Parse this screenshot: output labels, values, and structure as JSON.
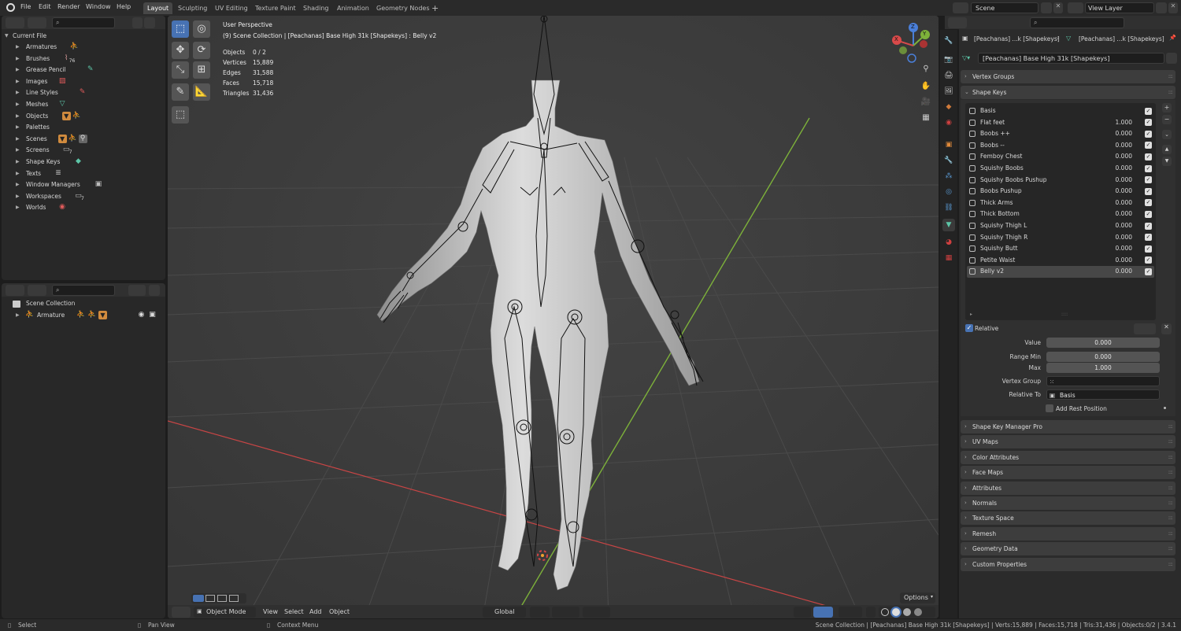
{
  "menu": {
    "items": [
      "File",
      "Edit",
      "Render",
      "Window",
      "Help"
    ],
    "workspaces": [
      "Layout",
      "Sculpting",
      "UV Editing",
      "Texture Paint",
      "Shading",
      "Animation",
      "Geometry Nodes"
    ],
    "add_tab": "+",
    "scene_name": "Scene",
    "view_layer": "View Layer"
  },
  "outliner_top": {
    "root": "Current File",
    "items": [
      {
        "label": "Armatures",
        "icon": "armature-icon"
      },
      {
        "label": "Brushes",
        "icon": "brush-icon",
        "count": "76"
      },
      {
        "label": "Grease Pencil",
        "icon": "grease-pencil-icon"
      },
      {
        "label": "Images",
        "icon": "image-icon"
      },
      {
        "label": "Line Styles",
        "icon": "line-style-icon"
      },
      {
        "label": "Meshes",
        "icon": "mesh-icon"
      },
      {
        "label": "Objects",
        "icon": "object-icon"
      },
      {
        "label": "Palettes",
        "icon": ""
      },
      {
        "label": "Scenes",
        "icon": "scene-icon"
      },
      {
        "label": "Screens",
        "icon": "screen-icon",
        "count": "7"
      },
      {
        "label": "Shape Keys",
        "icon": "shape-key-icon"
      },
      {
        "label": "Texts",
        "icon": "text-icon"
      },
      {
        "label": "Window Managers",
        "icon": "window-icon"
      },
      {
        "label": "Workspaces",
        "icon": "workspace-icon",
        "count": "7"
      },
      {
        "label": "Worlds",
        "icon": "world-icon"
      }
    ]
  },
  "outliner_bottom": {
    "collection": "Scene Collection",
    "armature": "Armature"
  },
  "viewport": {
    "perspective": "User Perspective",
    "collection_path": "(9) Scene Collection | [Peachanas] Base High 31k [Shapekeys] : Belly v2",
    "stats": [
      {
        "k": "Objects",
        "v": "0 / 2"
      },
      {
        "k": "Vertices",
        "v": "15,889"
      },
      {
        "k": "Edges",
        "v": "31,588"
      },
      {
        "k": "Faces",
        "v": "15,718"
      },
      {
        "k": "Triangles",
        "v": "31,436"
      }
    ],
    "gizmo": {
      "x": "X",
      "y": "Y",
      "z": "Z"
    },
    "options": "Options",
    "header": {
      "mode": "Object Mode",
      "menus": [
        "View",
        "Select",
        "Add",
        "Object"
      ],
      "orientation": "Global"
    },
    "colors": {
      "x_axis": "#d94a4a",
      "y_axis": "#7db13a",
      "z_axis": "#4a7fd9"
    }
  },
  "properties": {
    "breadcrumb_obj": "[Peachanas] ...k [Shapekeys]",
    "breadcrumb_data": "[Peachanas] ...k [Shapekeys]",
    "mesh_name": "[Peachanas] Base High 31k [Shapekeys]",
    "vertex_groups": "Vertex Groups",
    "shape_keys_title": "Shape Keys",
    "shape_keys": [
      {
        "name": "Basis",
        "value": ""
      },
      {
        "name": "Flat feet",
        "value": "1.000"
      },
      {
        "name": "Boobs ++",
        "value": "0.000"
      },
      {
        "name": "Boobs --",
        "value": "0.000"
      },
      {
        "name": "Femboy Chest",
        "value": "0.000"
      },
      {
        "name": "Squishy Boobs",
        "value": "0.000"
      },
      {
        "name": "Squishy Boobs Pushup",
        "value": "0.000"
      },
      {
        "name": "Boobs Pushup",
        "value": "0.000"
      },
      {
        "name": "Thick Arms",
        "value": "0.000"
      },
      {
        "name": "Thick Bottom",
        "value": "0.000"
      },
      {
        "name": "Squishy Thigh L",
        "value": "0.000"
      },
      {
        "name": "Squishy Thigh R",
        "value": "0.000"
      },
      {
        "name": "Squishy Butt",
        "value": "0.000"
      },
      {
        "name": "Petite Waist",
        "value": "0.000"
      },
      {
        "name": "Belly v2",
        "value": "0.000"
      }
    ],
    "relative": "Relative",
    "value_label": "Value",
    "value": "0.000",
    "range_min_label": "Range Min",
    "range_min": "0.000",
    "max_label": "Max",
    "max": "1.000",
    "vertex_group_label": "Vertex Group",
    "relative_to_label": "Relative To",
    "relative_to": "Basis",
    "add_rest_position": "Add Rest Position",
    "panels": [
      "Shape Key Manager Pro",
      "UV Maps",
      "Color Attributes",
      "Face Maps",
      "Attributes",
      "Normals",
      "Texture Space",
      "Remesh",
      "Geometry Data",
      "Custom Properties"
    ]
  },
  "statusbar": {
    "select": "Select",
    "pan": "Pan View",
    "context": "Context Menu",
    "info": "Scene Collection | [Peachanas] Base High 31k [Shapekeys] | Verts:15,889 | Faces:15,718 | Tris:31,436 | Objects:0/2 | 3.4.1"
  }
}
